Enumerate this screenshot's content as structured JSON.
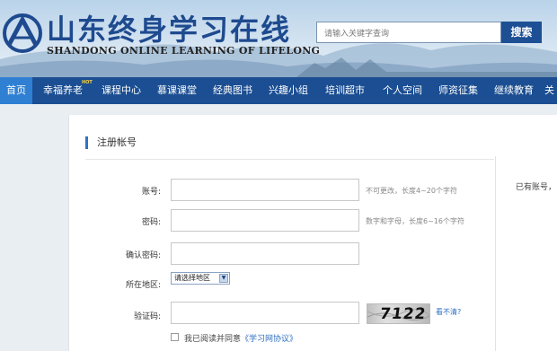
{
  "header": {
    "logo_title": "山东终身学习在线",
    "logo_subtitle": "SHANDONG ONLINE LEARNING OF LIFELONG",
    "search_placeholder": "请输入关键字查询",
    "search_button": "搜索"
  },
  "nav": {
    "items": [
      {
        "label": "首页",
        "active": true
      },
      {
        "label": "幸福养老",
        "badge": "HOT"
      },
      {
        "label": "课程中心"
      },
      {
        "label": "慕课课堂"
      },
      {
        "label": "经典图书"
      },
      {
        "label": "兴趣小组"
      },
      {
        "label": "培训超市"
      },
      {
        "label": "个人空间"
      },
      {
        "label": "师资征集"
      },
      {
        "label": "继续教育"
      },
      {
        "label": "关"
      }
    ]
  },
  "form": {
    "section_title": "注册帐号",
    "side_text": "已有账号，",
    "account_label": "账号:",
    "account_hint": "不可更改，长度4~20个字符",
    "password_label": "密码:",
    "password_hint": "数字和字母，长度6~16个字符",
    "confirm_label": "确认密码:",
    "region_label": "所在地区:",
    "region_selected": "请选择地区",
    "captcha_label": "验证码:",
    "captcha_value": "7122",
    "captcha_refresh": "看不清?",
    "agree_text": "我已阅读并同意",
    "agree_link": "《学习网协议》"
  },
  "colors": {
    "nav_bg": "#1b4e92",
    "nav_active": "#2f80d3",
    "search_button_bg": "#1d4f95",
    "link": "#2f6fc2"
  }
}
